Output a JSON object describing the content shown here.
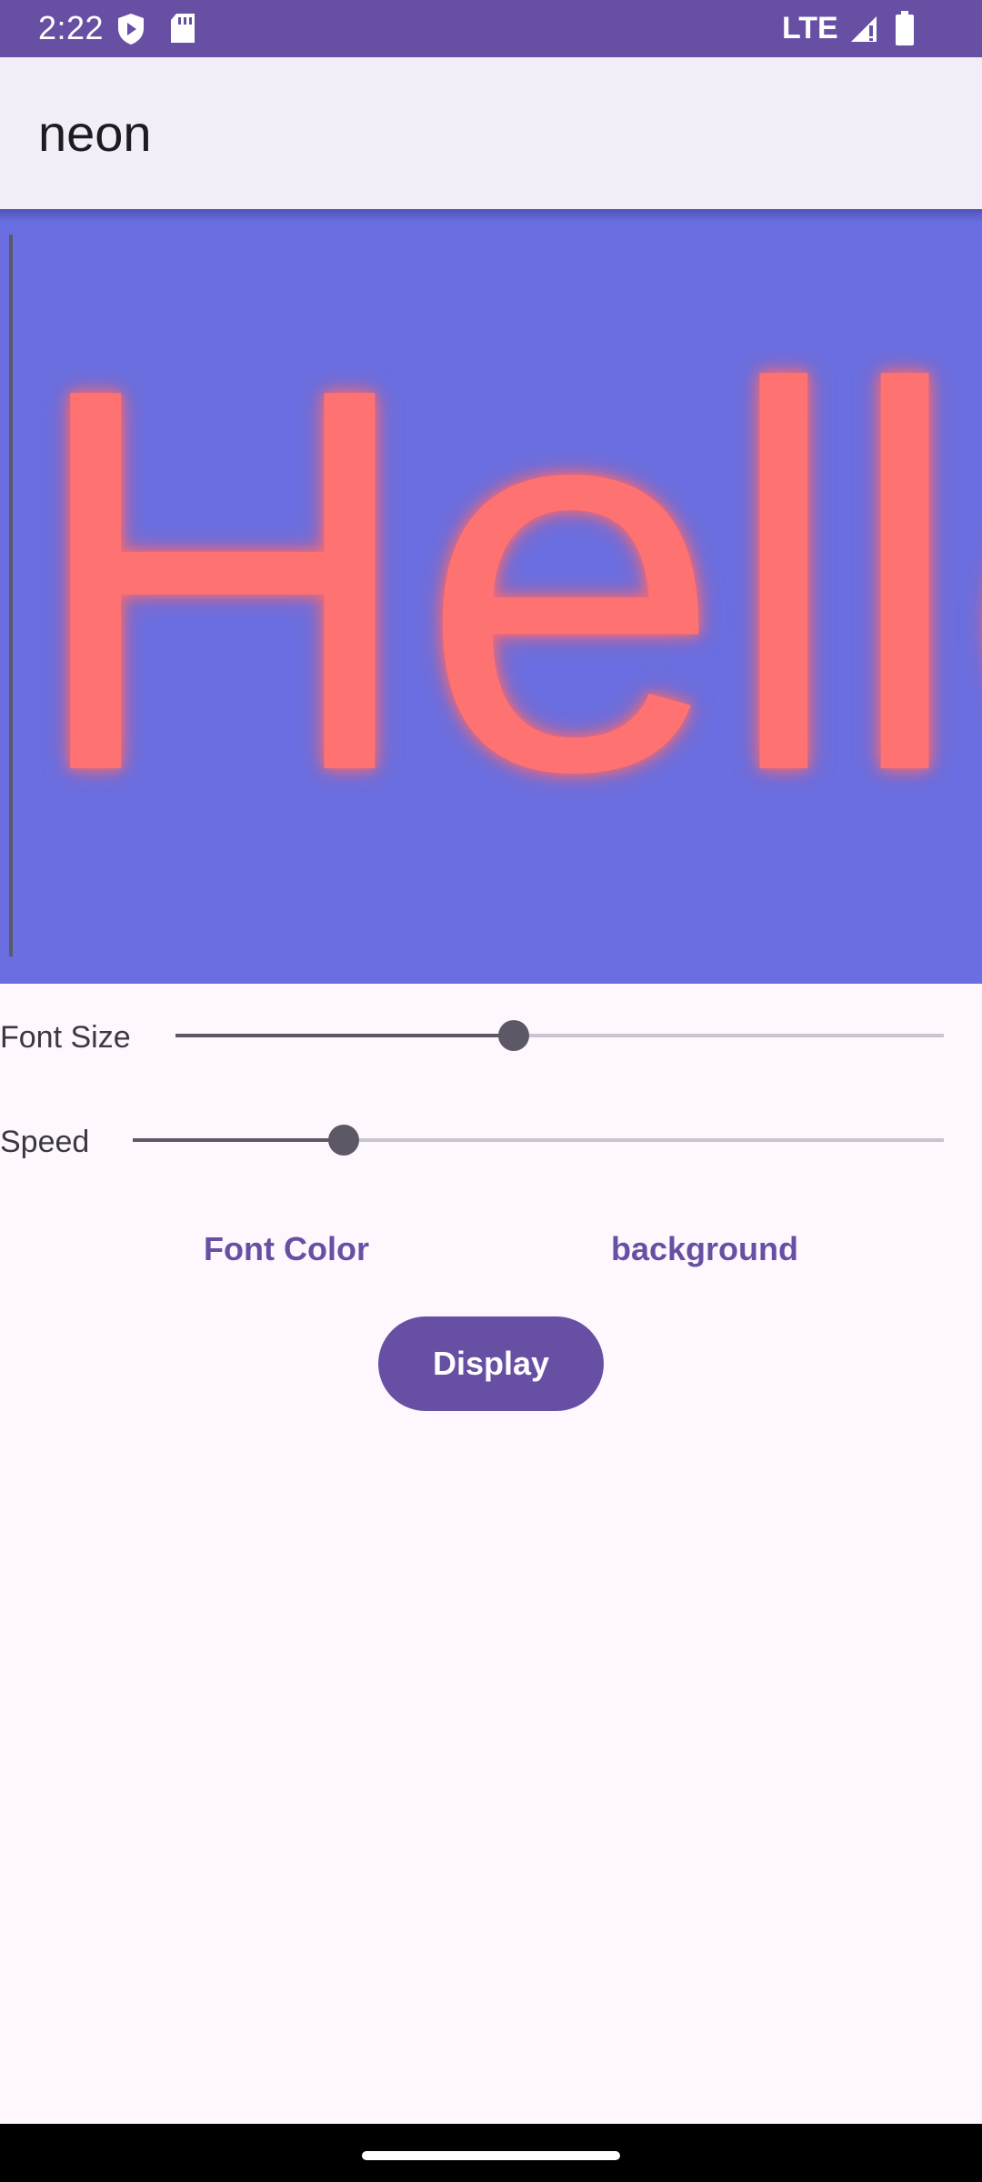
{
  "status_bar": {
    "time": "2:22",
    "network": "LTE",
    "icons": [
      "shield-play-icon",
      "sd-card-icon",
      "signal-icon",
      "battery-icon"
    ]
  },
  "app_bar": {
    "title": "neon"
  },
  "preview": {
    "text": "Hello",
    "font_color": "#FF7272",
    "background_color": "#6A6EE0"
  },
  "controls": {
    "font_size": {
      "label": "Font Size",
      "value": 0.44
    },
    "speed": {
      "label": "Speed",
      "value": 0.26
    },
    "font_color_button": "Font Color",
    "background_button": "background",
    "display_button": "Display"
  },
  "colors": {
    "accent": "#6750A4",
    "app_bar_bg": "#F3EDF7",
    "page_bg": "#FEF7FE"
  }
}
